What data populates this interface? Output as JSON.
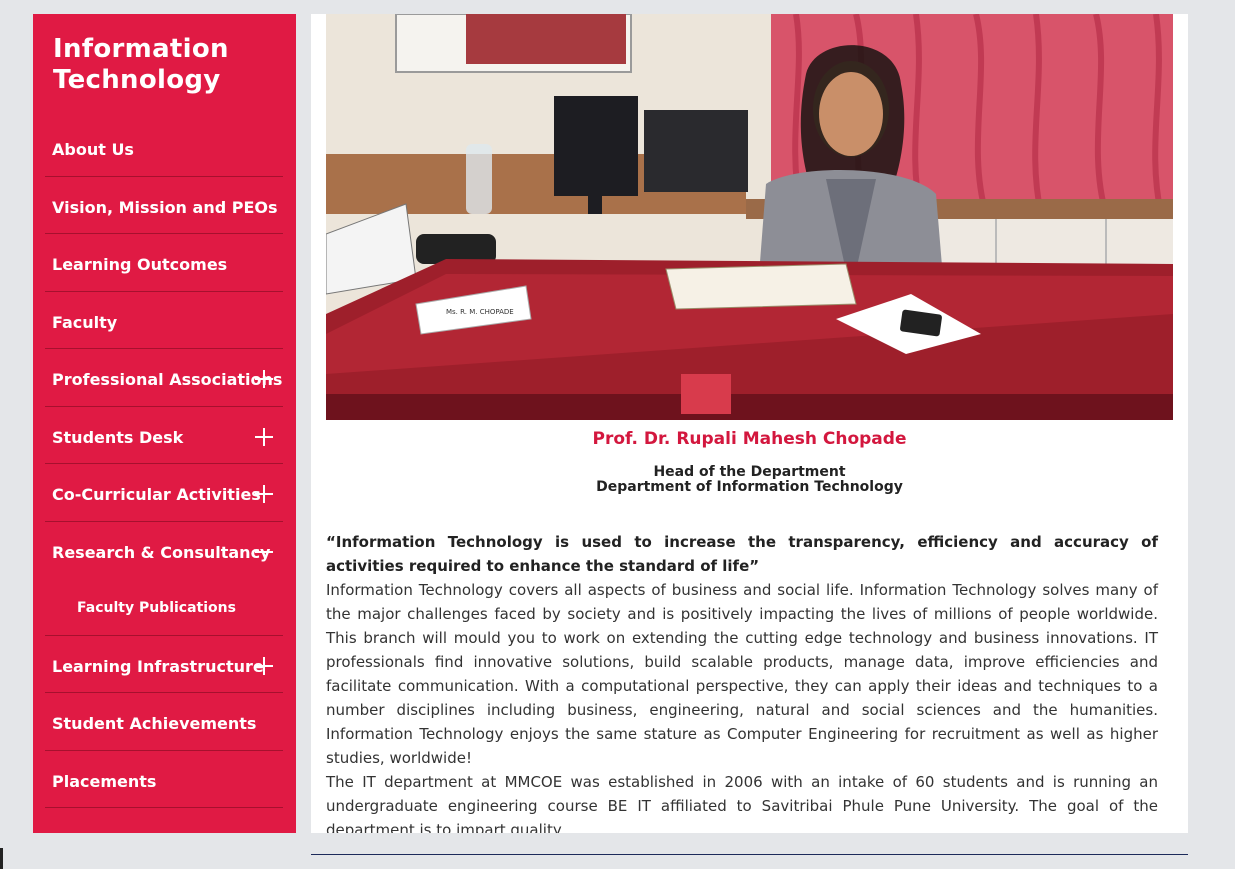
{
  "sidebar": {
    "title": "Information Technology",
    "items": [
      {
        "label": "About Us"
      },
      {
        "label": "Vision, Mission and PEOs"
      },
      {
        "label": "Learning Outcomes"
      },
      {
        "label": "Faculty"
      },
      {
        "label": "Professional Associations",
        "toggle": "plus"
      },
      {
        "label": "Students Desk",
        "toggle": "plus"
      },
      {
        "label": "Co-Curricular Activities",
        "toggle": "plus"
      },
      {
        "label": "Research & Consultancy",
        "toggle": "minus",
        "subitems": [
          "Faculty Publications"
        ]
      },
      {
        "label": "Learning Infrastructure",
        "toggle": "plus"
      },
      {
        "label": "Student Achievements"
      },
      {
        "label": "Placements"
      }
    ]
  },
  "main": {
    "photo": {
      "nameplate": "Ms. R. M. CHOPADE"
    },
    "hod_name": "Prof. Dr. Rupali Mahesh Chopade",
    "hod_role_line1": "Head of the Department",
    "hod_role_line2": "Department of Information Technology",
    "quote": "“Information Technology is used to increase the transparency, efficiency and accuracy of activities required to enhance the standard of life”",
    "paragraph1": "Information Technology covers all aspects of business and social life. Information Technology solves many of the major challenges faced by society and is positively impacting the lives of millions of people worldwide. This branch will mould you to work on extending the cutting edge technology and business innovations. IT professionals find innovative solutions, build scalable products, manage data, improve efficiencies and facilitate communication. With a computational perspective, they can apply their ideas and techniques to a number disciplines including business, engineering, natural and social sciences and the humanities. Information Technology enjoys the same stature as Computer Engineering for recruitment as well as higher studies, worldwide!",
    "paragraph2": "The IT department at MMCOE was established in 2006 with an intake of 60 students and is running an undergraduate engineering course BE IT affiliated to Savitribai Phule Pune University. The goal of the department is to impart quality"
  },
  "colors": {
    "sidebar_bg": "#e01a44",
    "accent": "#d3173e",
    "page_bg": "#e4e6e9"
  }
}
